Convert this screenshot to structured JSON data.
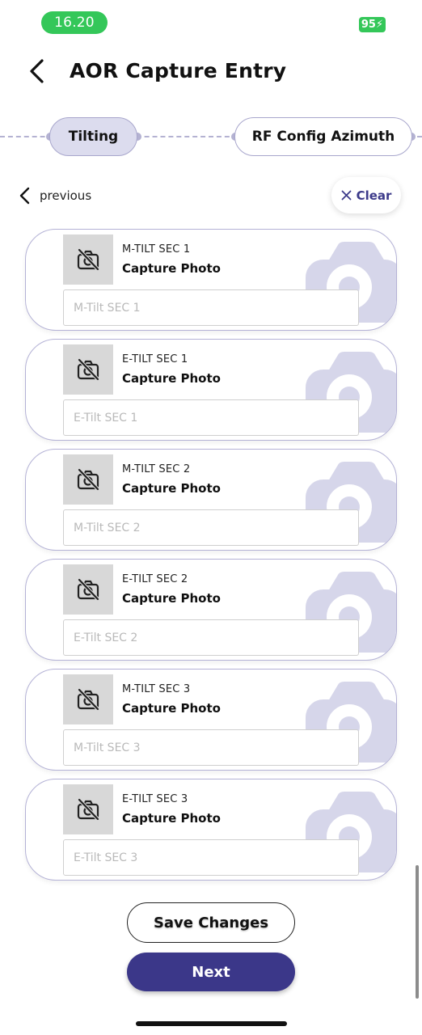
{
  "status_bar": {
    "time": "16.20",
    "battery": "95"
  },
  "header": {
    "title": "AOR Capture Entry"
  },
  "stepper": {
    "current": "Tilting",
    "next": "RF Config Azimuth"
  },
  "nav": {
    "previous_label": "previous",
    "clear_label": "Clear"
  },
  "colors": {
    "accent": "#3b3789",
    "stepper": "#b4b2d2",
    "status_green": "#34c759",
    "card_border": "#b4b2d6"
  },
  "cards": [
    {
      "label": "M-TILT SEC 1",
      "action": "Capture Photo",
      "placeholder": "M-Tilt SEC 1"
    },
    {
      "label": "E-TILT SEC 1",
      "action": "Capture Photo",
      "placeholder": "E-Tilt SEC 1"
    },
    {
      "label": "M-TILT SEC 2",
      "action": "Capture Photo",
      "placeholder": "M-Tilt SEC 2"
    },
    {
      "label": "E-TILT SEC 2",
      "action": "Capture Photo",
      "placeholder": "E-Tilt SEC 2"
    },
    {
      "label": "M-TILT SEC 3",
      "action": "Capture Photo",
      "placeholder": "M-Tilt SEC 3"
    },
    {
      "label": "E-TILT SEC 3",
      "action": "Capture Photo",
      "placeholder": "E-Tilt SEC 3"
    }
  ],
  "footer": {
    "save_label": "Save Changes",
    "next_label": "Next"
  }
}
